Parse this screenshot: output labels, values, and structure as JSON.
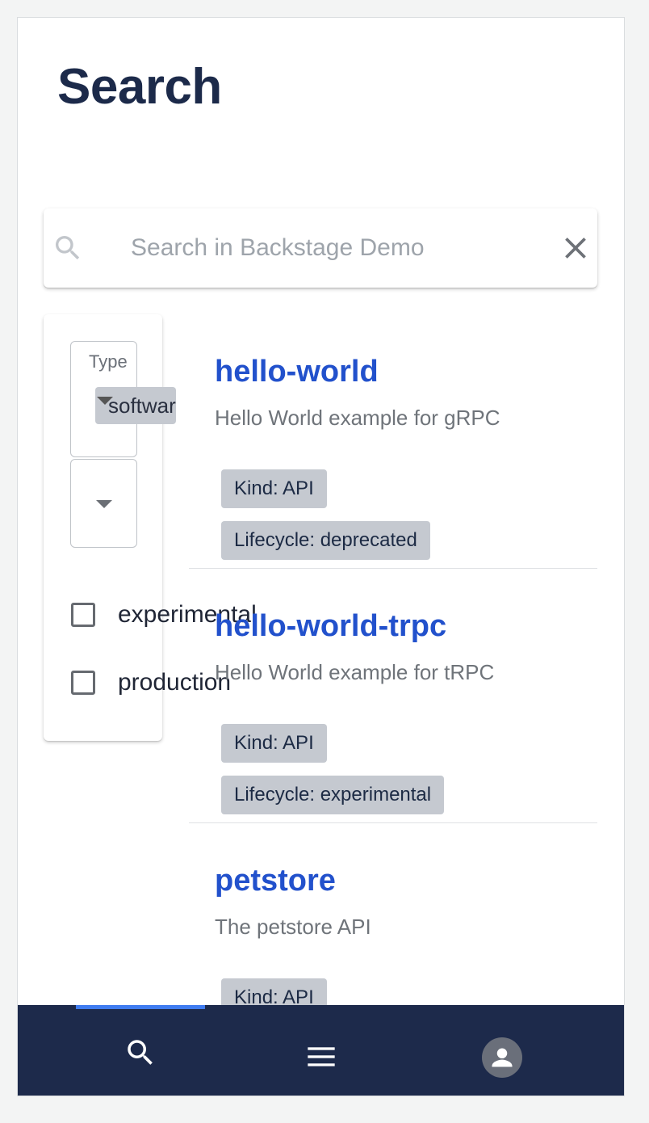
{
  "page": {
    "title": "Search"
  },
  "search": {
    "placeholder": "Search in Backstage Demo",
    "value": ""
  },
  "filters": {
    "type_label": "Type",
    "type_selected": "software",
    "lifecycle_options": [
      {
        "label": "experimental",
        "checked": false
      },
      {
        "label": "production",
        "checked": false
      }
    ]
  },
  "results": [
    {
      "title": "hello-world",
      "description": "Hello World example for gRPC",
      "tags": [
        "Kind: API",
        "Lifecycle: deprecated"
      ]
    },
    {
      "title": "hello-world-trpc",
      "description": "Hello World example for tRPC",
      "tags": [
        "Kind: API",
        "Lifecycle: experimental"
      ]
    },
    {
      "title": "petstore",
      "description": "The petstore API",
      "tags": [
        "Kind: API"
      ]
    }
  ],
  "bottom_nav": {
    "items": [
      {
        "icon": "search-icon",
        "active": true
      },
      {
        "icon": "menu-icon",
        "active": false
      },
      {
        "icon": "account-icon",
        "active": false
      }
    ]
  },
  "colors": {
    "title": "#1c2a4a",
    "link": "#2251cc",
    "nav_background": "#1d2a4b",
    "nav_indicator": "#3f7cf0",
    "tag_background": "#c5c9d0"
  }
}
